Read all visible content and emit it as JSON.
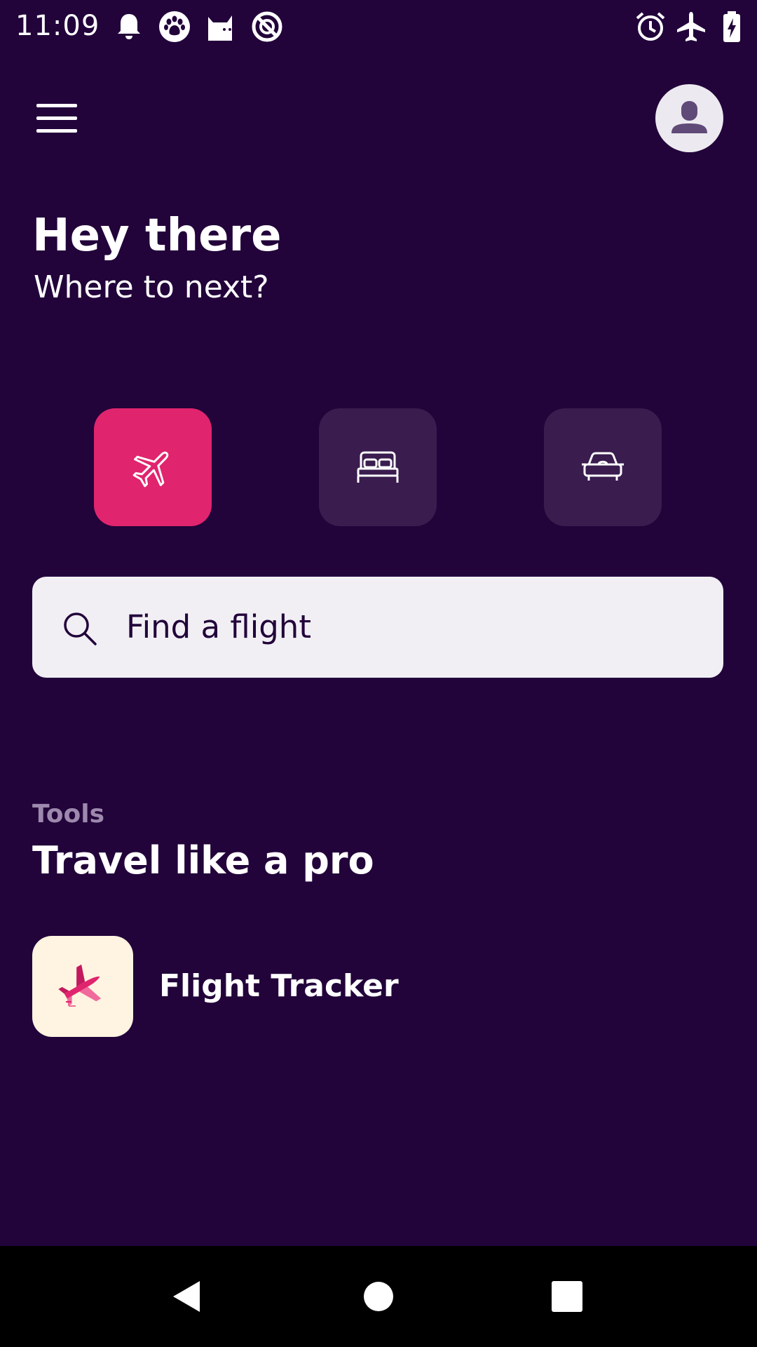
{
  "status_bar": {
    "time": "11:09",
    "left_icons": [
      "bell-icon",
      "paw-icon",
      "cat-icon",
      "no-sync-icon"
    ],
    "right_icons": [
      "alarm-icon",
      "airplane-mode-icon",
      "battery-charging-icon"
    ]
  },
  "header": {
    "menu_icon": "hamburger-menu-icon",
    "avatar_icon": "person-icon"
  },
  "hero": {
    "greeting": "Hey there",
    "subtitle": "Where to next?"
  },
  "categories": [
    {
      "id": "flights",
      "icon": "airplane-icon",
      "selected": true
    },
    {
      "id": "hotels",
      "icon": "bed-icon",
      "selected": false
    },
    {
      "id": "car-hire",
      "icon": "car-icon",
      "selected": false
    }
  ],
  "search": {
    "placeholder": "Find a flight",
    "icon": "search-icon"
  },
  "tools_section": {
    "eyebrow": "Tools",
    "title": "Travel like a pro",
    "items": [
      {
        "label": "Flight Tracker",
        "icon": "flight-tracker-icon"
      }
    ]
  },
  "nav_bar": {
    "buttons": [
      "back-icon",
      "home-icon",
      "recents-icon"
    ]
  },
  "colors": {
    "background": "#22033a",
    "accent": "#e0246e",
    "tile": "#3a1c4f",
    "search_bg": "#f1eff4",
    "eyebrow": "#9c89ad"
  }
}
